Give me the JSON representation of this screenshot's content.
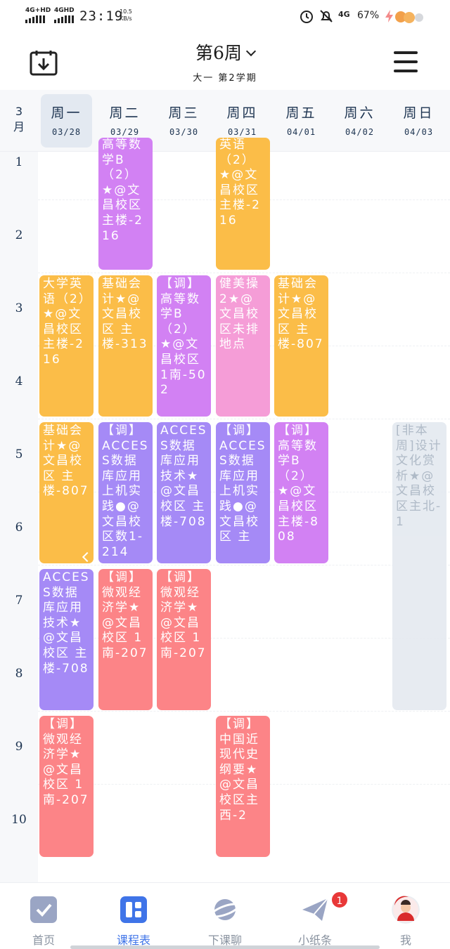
{
  "status_bar": {
    "sim1": "4G+HD",
    "sim2": "4GHD",
    "time": "23:19",
    "speed_value": "10.5",
    "speed_unit": "KB/s",
    "network": "4G",
    "battery": "67%"
  },
  "header": {
    "week_title": "第6周",
    "semester": "大一 第2学期"
  },
  "day_header": {
    "month_line1": "3",
    "month_line2": "月",
    "days": [
      {
        "name": "周一",
        "date": "03/28"
      },
      {
        "name": "周二",
        "date": "03/29"
      },
      {
        "name": "周三",
        "date": "03/30"
      },
      {
        "name": "周四",
        "date": "03/31"
      },
      {
        "name": "周五",
        "date": "04/01"
      },
      {
        "name": "周六",
        "date": "04/02"
      },
      {
        "name": "周日",
        "date": "04/03"
      }
    ]
  },
  "periods": [
    "1",
    "2",
    "3",
    "4",
    "5",
    "6",
    "7",
    "8",
    "9",
    "10"
  ],
  "courses": [
    {
      "text": "高等数学B（2）★@文昌校区 主楼-216",
      "color": "#d281f3"
    },
    {
      "text": "英语（2）★@文昌校区 主楼-216",
      "color": "#fbbd48"
    },
    {
      "text": "大学英语（2）★@文昌校区 主楼-216",
      "color": "#fbbd48"
    },
    {
      "text": "基础会计★@文昌校区 主楼-313",
      "color": "#fbbd48"
    },
    {
      "text": "【调】高等数学B（2）★@文昌校区 1南-502",
      "color": "#d281f3"
    },
    {
      "text": "健美操2★@文昌校区未排地点",
      "color": "#f59dd7"
    },
    {
      "text": "基础会计★@文昌校区 主楼-807",
      "color": "#fbbd48"
    },
    {
      "text": "基础会计★@文昌校区 主楼-807",
      "color": "#fbbd48"
    },
    {
      "text": "【调】ACCESS数据库应用上机实践●@文昌校区数1-214",
      "color": "#a58af6"
    },
    {
      "text": "ACCESS数据库应用技术★@文昌校区 主楼-708",
      "color": "#a58af6"
    },
    {
      "text": "【调】ACCESS数据库应用上机实践●@文昌校区 主",
      "color": "#a58af6"
    },
    {
      "text": "【调】高等数学B（2）★@文昌校区 主楼-808",
      "color": "#d281f3"
    },
    {
      "text": "[非本周]设计文化赏析★@文昌校区主北-1",
      "color": "#e4e9f0"
    },
    {
      "text": "ACCESS数据库应用技术★@文昌校区 主楼-708",
      "color": "#a58af6"
    },
    {
      "text": "【调】微观经济学★@文昌校区 1南-207",
      "color": "#fc8487"
    },
    {
      "text": "【调】微观经济学★@文昌校区 1南-207",
      "color": "#fc8487"
    },
    {
      "text": "【调】微观经济学★@文昌校区 1南-207",
      "color": "#fc8487"
    },
    {
      "text": "【调】中国近现代史纲要★@文昌校区主西-2",
      "color": "#fc8487"
    }
  ],
  "bottom_nav": {
    "items": [
      {
        "label": "首页",
        "icon": "check-square-icon"
      },
      {
        "label": "课程表",
        "icon": "timetable-icon"
      },
      {
        "label": "下课聊",
        "icon": "planet-icon"
      },
      {
        "label": "小纸条",
        "icon": "paper-plane-icon"
      },
      {
        "label": "我",
        "icon": "avatar-icon"
      }
    ],
    "badge": "1"
  }
}
